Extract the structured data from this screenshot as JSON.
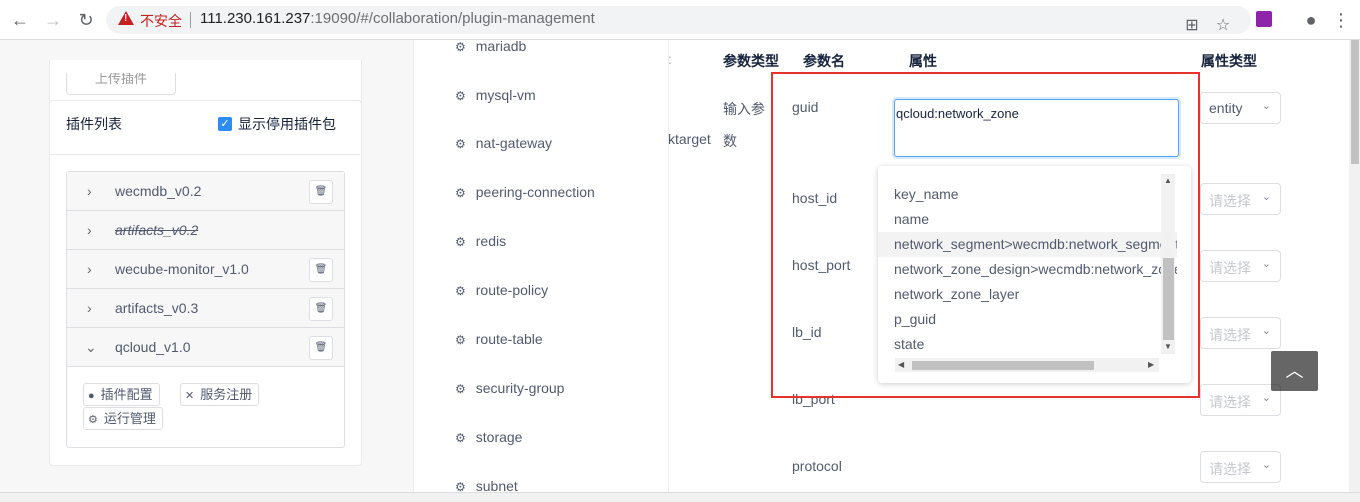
{
  "browser": {
    "insecure_label": "不安全",
    "url_host": "111.230.161.237",
    "url_rest": ":19090/#/collaboration/plugin-management"
  },
  "left": {
    "upload_label": "上传插件",
    "plugin_list_title": "插件列表",
    "show_disabled_label": "显示停用插件包",
    "packages": [
      {
        "name": "wecmdb_v0.2",
        "disabled": false,
        "expanded": false
      },
      {
        "name": "artifacts_v0.2",
        "disabled": true,
        "expanded": false
      },
      {
        "name": "wecube-monitor_v1.0",
        "disabled": false,
        "expanded": false
      },
      {
        "name": "artifacts_v0.3",
        "disabled": false,
        "expanded": false
      },
      {
        "name": "qcloud_v1.0",
        "disabled": false,
        "expanded": true
      }
    ],
    "actions": {
      "plugin_config": "插件配置",
      "service_register": "服务注册",
      "runtime_manage": "运行管理"
    }
  },
  "resources": [
    "mariadb",
    "mysql-vm",
    "nat-gateway",
    "peering-connection",
    "redis",
    "route-policy",
    "route-table",
    "security-group",
    "storage",
    "subnet"
  ],
  "table": {
    "headers": {
      "param_type": "参数类型",
      "param_name": "参数名",
      "attribute": "属性",
      "attribute_type": "属性类型"
    },
    "row_type_line1": "输入参",
    "row_type_line2": "数",
    "left_cut_text": "ktarget",
    "params": [
      "guid",
      "host_id",
      "host_port",
      "lb_id",
      "lb_port",
      "protocol"
    ],
    "guid_value": "qcloud:network_zone",
    "entity_label": "entity",
    "select_placeholder": "请选择"
  },
  "dropdown": {
    "options": [
      "key_name",
      "name",
      "network_segment>wecmdb:network_segment",
      "network_zone_design>wecmdb:network_zone_design",
      "network_zone_layer",
      "p_guid",
      "state"
    ],
    "highlighted_index": 2
  },
  "colors": {
    "primary": "#2d8cf0",
    "highlight_box": "#e5322d"
  }
}
